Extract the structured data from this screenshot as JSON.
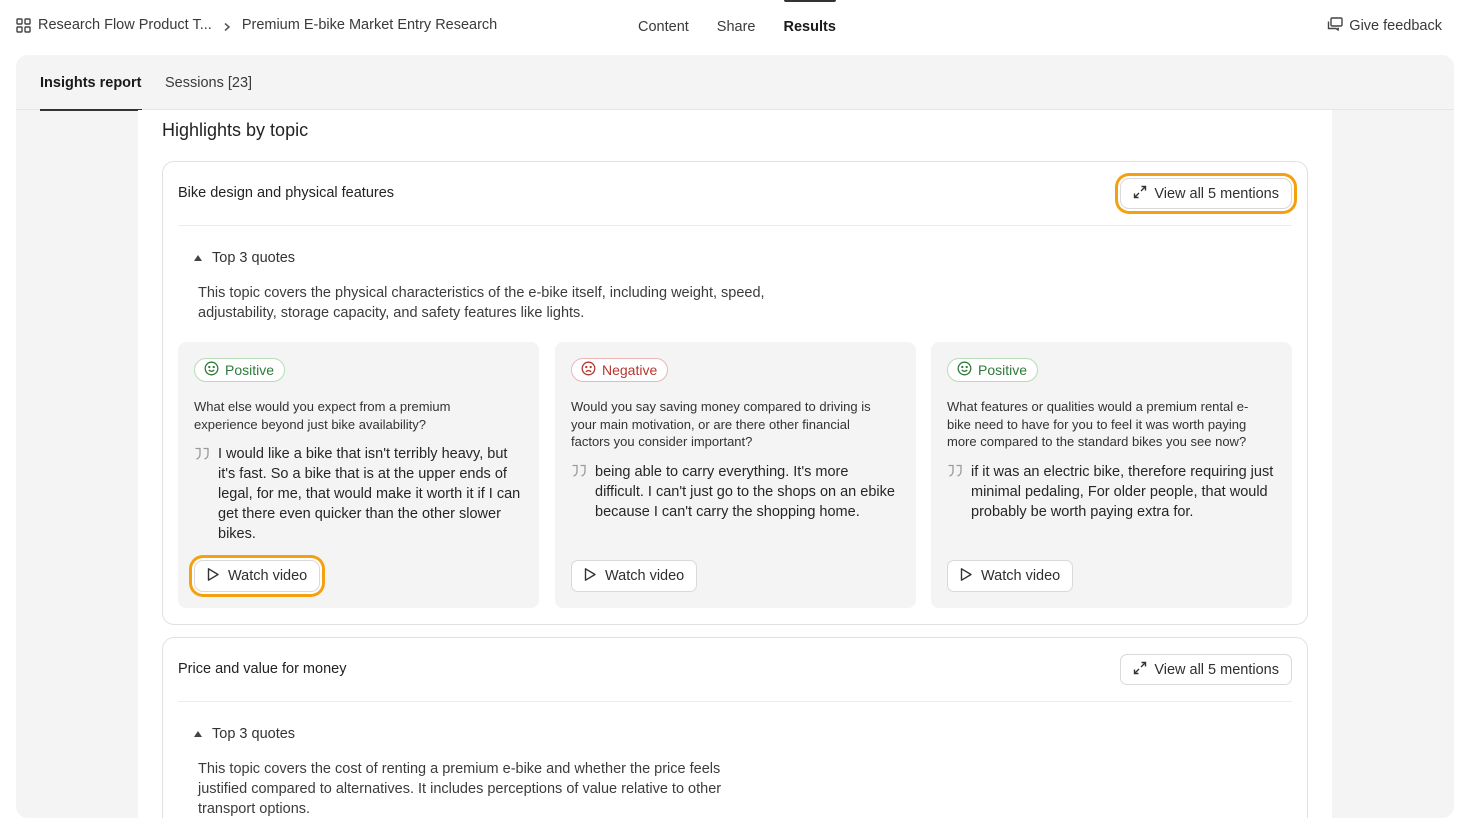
{
  "header": {
    "breadcrumb": [
      "Research Flow Product T...",
      "Premium E-bike Market Entry Research"
    ],
    "nav": [
      "Content",
      "Share",
      "Results"
    ],
    "nav_active": "Results",
    "feedback_label": "Give feedback"
  },
  "tabs": [
    "Insights report",
    "Sessions [23]"
  ],
  "section_title": "Highlights by topic",
  "topics": [
    {
      "title": "Bike design and physical features",
      "mentions_label": "View all 5 mentions",
      "toggle_label": "Top 3 quotes",
      "summary": "This topic covers the physical characteristics of the e-bike itself, including weight, speed, adjustability, storage capacity, and safety features like lights.",
      "quotes": [
        {
          "sentiment": "Positive",
          "question": "What else would you expect from a premium experience beyond just bike availability?",
          "quote": "I would like a bike that isn't terribly heavy, but it's fast. So a bike that is at the upper ends of legal, for me, that would make it worth it if I can get there even quicker than the other slower bikes.",
          "video_label": "Watch video"
        },
        {
          "sentiment": "Negative",
          "question": "Would you say saving money compared to driving is your main motivation, or are there other financial factors you consider important?",
          "quote": "being able to carry everything. It's more difficult. I can't just go to the shops on an ebike because I can't carry the shopping home.",
          "video_label": "Watch video"
        },
        {
          "sentiment": "Positive",
          "question": "What features or qualities would a premium rental e-bike need to have for you to feel it was worth paying more compared to the standard bikes you see now?",
          "quote": "if it was an electric bike, therefore requiring just minimal pedaling, For older people, that would probably be worth paying extra for.",
          "video_label": "Watch video"
        }
      ]
    },
    {
      "title": "Price and value for money",
      "mentions_label": "View all 5 mentions",
      "toggle_label": "Top 3 quotes",
      "summary": "This topic covers the cost of renting a premium e-bike and whether the price feels justified compared to alternatives. It includes perceptions of value relative to other transport options."
    }
  ],
  "colors": {
    "highlight": "#f5a00f",
    "positive": "#2f7a3a",
    "negative": "#b3372d",
    "panel_bg": "#f4f4f4"
  },
  "icons": [
    "grid-icon",
    "chevron-right-icon",
    "feedback-icon",
    "expand-icon",
    "smile-icon",
    "frown-icon",
    "quote-icon",
    "play-icon",
    "caret-up-icon"
  ]
}
